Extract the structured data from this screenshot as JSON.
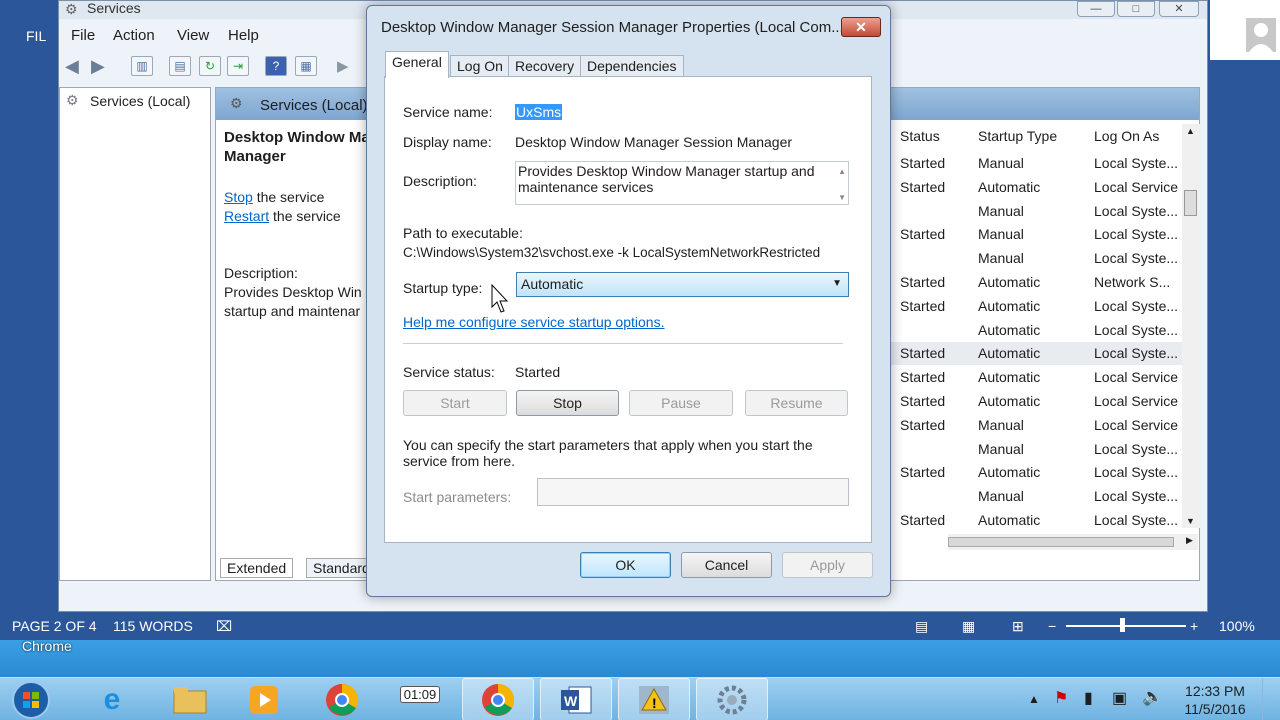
{
  "word": {
    "left_label": "FIL",
    "status": {
      "page": "PAGE 2 OF 4",
      "words": "115 WORDS",
      "zoom": "100%"
    }
  },
  "taskbar": {
    "chrome_label": "Chrome",
    "timer_badge": "01:09",
    "time": "12:33 PM",
    "date": "11/5/2016"
  },
  "services": {
    "title": "Services",
    "menu": [
      "File",
      "Action",
      "View",
      "Help"
    ],
    "tree_item": "Services (Local)",
    "header": "Services (Local)",
    "detail_title": "Desktop Window Ma",
    "detail_title2": "Manager",
    "stop_link": "Stop",
    "stop_rest": " the service",
    "restart_link": "Restart",
    "restart_rest": " the service",
    "description_label": "Description:",
    "description_line1": "Provides Desktop Win",
    "description_line2": "startup and maintenar",
    "columns": {
      "status": "Status",
      "startup": "Startup Type",
      "logon": "Log On As"
    },
    "rows": [
      {
        "status": "Started",
        "startup": "Manual",
        "logon": "Local Syste..."
      },
      {
        "status": "Started",
        "startup": "Automatic",
        "logon": "Local Service"
      },
      {
        "status": "",
        "startup": "Manual",
        "logon": "Local Syste..."
      },
      {
        "status": "Started",
        "startup": "Manual",
        "logon": "Local Syste..."
      },
      {
        "status": "",
        "startup": "Manual",
        "logon": "Local Syste..."
      },
      {
        "status": "Started",
        "startup": "Automatic",
        "logon": "Network S..."
      },
      {
        "status": "Started",
        "startup": "Automatic",
        "logon": "Local Syste..."
      },
      {
        "status": "",
        "startup": "Automatic",
        "logon": "Local Syste..."
      },
      {
        "status": "Started",
        "startup": "Automatic",
        "logon": "Local Syste..."
      },
      {
        "status": "Started",
        "startup": "Automatic",
        "logon": "Local Service"
      },
      {
        "status": "Started",
        "startup": "Automatic",
        "logon": "Local Service"
      },
      {
        "status": "Started",
        "startup": "Manual",
        "logon": "Local Service"
      },
      {
        "status": "",
        "startup": "Manual",
        "logon": "Local Syste..."
      },
      {
        "status": "Started",
        "startup": "Automatic",
        "logon": "Local Syste..."
      },
      {
        "status": "",
        "startup": "Manual",
        "logon": "Local Syste..."
      },
      {
        "status": "Started",
        "startup": "Automatic",
        "logon": "Local Syste..."
      }
    ],
    "tabs": [
      "Extended",
      "Standard"
    ]
  },
  "dialog": {
    "title": "Desktop Window Manager Session Manager Properties (Local Com...",
    "tabs": [
      "General",
      "Log On",
      "Recovery",
      "Dependencies"
    ],
    "service_name_label": "Service name:",
    "service_name": "UxSms",
    "display_name_label": "Display name:",
    "display_name": "Desktop Window Manager Session Manager",
    "description_label": "Description:",
    "description": "Provides Desktop Window Manager startup and maintenance services",
    "path_label": "Path to executable:",
    "path": "C:\\Windows\\System32\\svchost.exe -k LocalSystemNetworkRestricted",
    "startup_type_label": "Startup type:",
    "startup_type": "Automatic",
    "help_link": "Help me configure service startup options.",
    "status_label": "Service status:",
    "status": "Started",
    "buttons": {
      "start": "Start",
      "stop": "Stop",
      "pause": "Pause",
      "resume": "Resume"
    },
    "params_note": "You can specify the start parameters that apply when you start the service from here.",
    "params_label": "Start parameters:",
    "params_value": "",
    "ok": "OK",
    "cancel": "Cancel",
    "apply": "Apply"
  }
}
